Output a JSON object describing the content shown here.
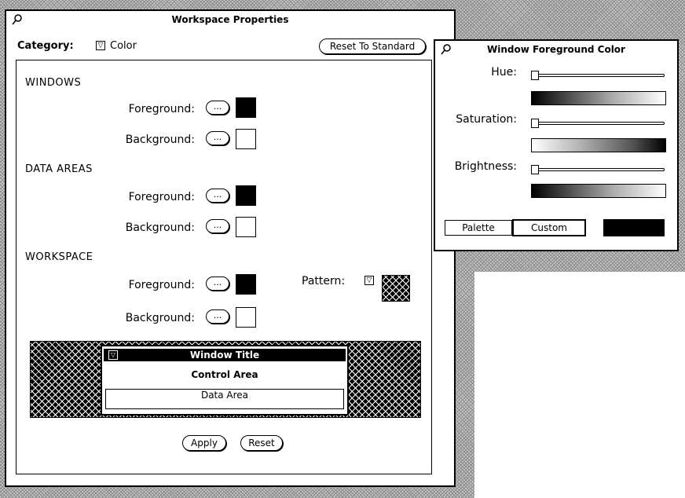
{
  "workspace_window": {
    "title": "Workspace Properties",
    "category_label": "Category:",
    "category_value": "Color",
    "reset_standard_label": "Reset To Standard",
    "sections": {
      "windows": "WINDOWS",
      "data_areas": "DATA AREAS",
      "workspace": "WORKSPACE"
    },
    "foreground_label": "Foreground:",
    "background_label": "Background:",
    "ellipsis": "...",
    "pattern_label": "Pattern:",
    "preview": {
      "window_title": "Window Title",
      "control_area": "Control Area",
      "data_area": "Data Area"
    },
    "apply_label": "Apply",
    "reset_label": "Reset"
  },
  "color_window": {
    "title": "Window Foreground Color",
    "hue_label": "Hue:",
    "saturation_label": "Saturation:",
    "brightness_label": "Brightness:",
    "palette_tab": "Palette",
    "custom_tab": "Custom"
  },
  "colors": {
    "desktop": "#c8c8c8",
    "window": "#ffffff",
    "ink": "#000000"
  }
}
